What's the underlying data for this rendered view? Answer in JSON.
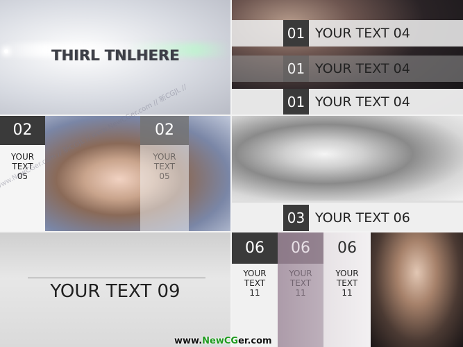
{
  "tile1": {
    "title": "THIRL TNLHERE"
  },
  "tile2": {
    "rows": [
      {
        "number": "01",
        "label": "YOUR TEXT 04"
      },
      {
        "number": "01",
        "label": "YOUR TEXT 04"
      },
      {
        "number": "01",
        "label": "YOUR TEXT 04"
      }
    ]
  },
  "tile3": {
    "panels": [
      {
        "number": "02",
        "text": "YOUR TEXT 05"
      },
      {
        "number": "02",
        "text": "YOUR TEXT 05"
      }
    ]
  },
  "tile4": {
    "number": "03",
    "label": "YOUR TEXT 06"
  },
  "tile5": {
    "title": "YOUR TEXT 09"
  },
  "tile6": {
    "panels": [
      {
        "number": "06",
        "text": "YOUR TEXT 11"
      },
      {
        "number": "06",
        "text": "YOUR TEXT 11"
      },
      {
        "number": "06",
        "text": "YOUR TEXT 11"
      }
    ]
  },
  "watermark": {
    "text": "www.NewCGer.com // 新CGJL // www.NewCGer.com // 新CGJL //"
  },
  "footer": {
    "prefix": "www.",
    "brand_a": "New",
    "brand_b": "CG",
    "suffix": "er.com"
  }
}
